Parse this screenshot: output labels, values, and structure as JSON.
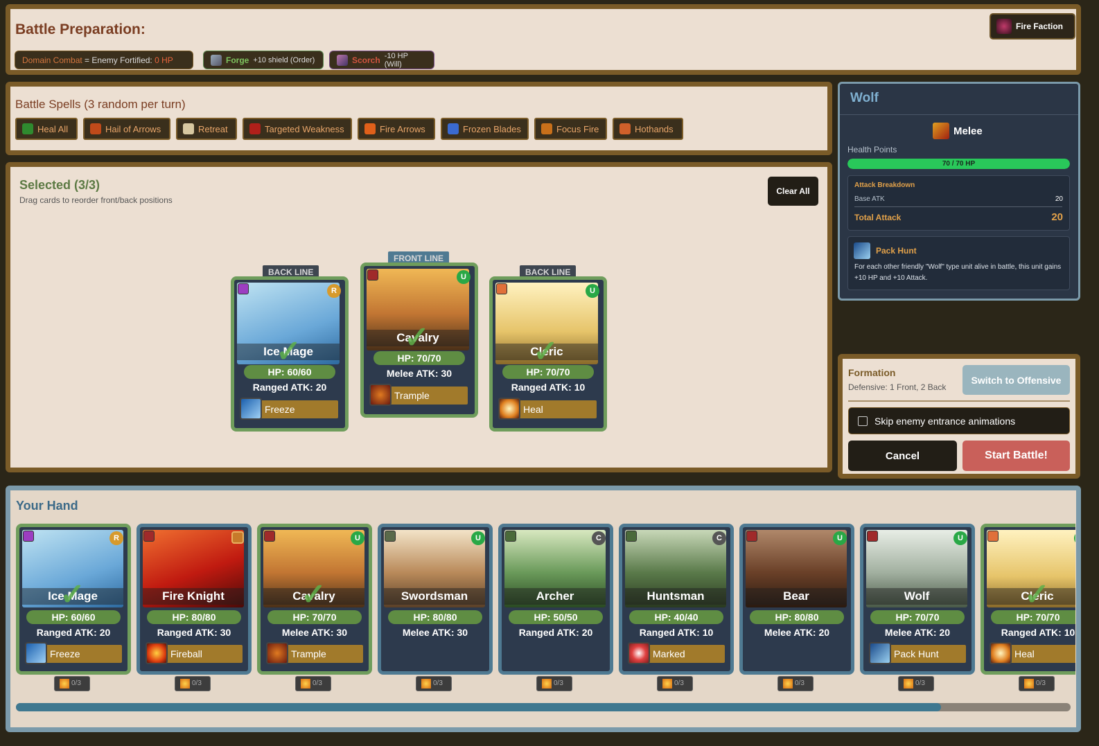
{
  "header": {
    "title": "Battle Preparation:",
    "faction_label": "Fire Faction",
    "domain": {
      "prefix": "Domain Combat",
      "eq": " = ",
      "effect": "Enemy Fortified: ",
      "value": "0 HP"
    },
    "forge": {
      "label": "Forge",
      "effect": "+10 shield (Order)"
    },
    "scorch": {
      "label": "Scorch",
      "effect": "-10 HP (Will)"
    }
  },
  "spells": {
    "title": "Battle Spells (3 random per turn)",
    "items": [
      "Heal All",
      "Hail of Arrows",
      "Retreat",
      "Targeted Weakness",
      "Fire Arrows",
      "Frozen Blades",
      "Focus Fire",
      "Hothands"
    ]
  },
  "selected": {
    "title": "Selected (3/3)",
    "subtitle": "Drag cards to reorder front/back positions",
    "clear_label": "Clear All",
    "cards": [
      {
        "line": "BACK LINE",
        "name": "Ice Mage",
        "hp": "HP: 60/60",
        "atk": "Ranged ATK: 20",
        "ability": "Freeze",
        "rarity": "R"
      },
      {
        "line": "FRONT LINE",
        "name": "Cavalry",
        "hp": "HP: 70/70",
        "atk": "Melee ATK: 30",
        "ability": "Trample",
        "rarity": "U"
      },
      {
        "line": "BACK LINE",
        "name": "Cleric",
        "hp": "HP: 70/70",
        "atk": "Ranged ATK: 10",
        "ability": "Heal",
        "rarity": "U"
      }
    ]
  },
  "detail": {
    "name": "Wolf",
    "type": "Melee",
    "hp_label": "Health Points",
    "hp_value": "70 / 70 HP",
    "hp_fraction": 1.0,
    "breakdown_title": "Attack Breakdown",
    "base_label": "Base ATK",
    "base_value": "20",
    "total_label": "Total Attack",
    "total_value": "20",
    "ability_name": "Pack Hunt",
    "ability_desc": "For each other friendly \"Wolf\" type unit alive in battle, this unit gains +10 HP and +10 Attack."
  },
  "formation": {
    "title": "Formation",
    "desc": "Defensive: 1 Front, 2 Back",
    "switch_label": "Switch to Offensive",
    "skip_label": "Skip enemy entrance animations",
    "cancel_label": "Cancel",
    "start_label": "Start Battle!"
  },
  "hand": {
    "title": "Your Hand",
    "cards": [
      {
        "name": "Ice Mage",
        "hp": "HP: 60/60",
        "atk": "Ranged ATK: 20",
        "ability": "Freeze",
        "rarity": "R",
        "count": "0/3",
        "selected": true
      },
      {
        "name": "Fire Knight",
        "hp": "HP: 80/80",
        "atk": "Ranged ATK: 30",
        "ability": "Fireball",
        "rarity": "",
        "count": "0/3",
        "selected": false
      },
      {
        "name": "Cavalry",
        "hp": "HP: 70/70",
        "atk": "Melee ATK: 30",
        "ability": "Trample",
        "rarity": "U",
        "count": "0/3",
        "selected": true
      },
      {
        "name": "Swordsman",
        "hp": "HP: 80/80",
        "atk": "Melee ATK: 30",
        "ability": "",
        "rarity": "U",
        "count": "0/3",
        "selected": false
      },
      {
        "name": "Archer",
        "hp": "HP: 50/50",
        "atk": "Ranged ATK: 20",
        "ability": "",
        "rarity": "C",
        "count": "0/3",
        "selected": false
      },
      {
        "name": "Huntsman",
        "hp": "HP: 40/40",
        "atk": "Ranged ATK: 10",
        "ability": "Marked",
        "rarity": "C",
        "count": "0/3",
        "selected": false
      },
      {
        "name": "Bear",
        "hp": "HP: 80/80",
        "atk": "Melee ATK: 20",
        "ability": "",
        "rarity": "U",
        "count": "0/3",
        "selected": false
      },
      {
        "name": "Wolf",
        "hp": "HP: 70/70",
        "atk": "Melee ATK: 20",
        "ability": "Pack Hunt",
        "rarity": "U",
        "count": "0/3",
        "selected": false
      },
      {
        "name": "Cleric",
        "hp": "HP: 70/70",
        "atk": "Ranged ATK: 10",
        "ability": "Heal",
        "rarity": "U",
        "count": "0/3",
        "selected": true
      }
    ]
  },
  "colors": {
    "rare": "#d79a2c",
    "uncommon": "#29a846",
    "common": "#555555",
    "accent": "#7a5b28",
    "start": "#c9605a"
  }
}
